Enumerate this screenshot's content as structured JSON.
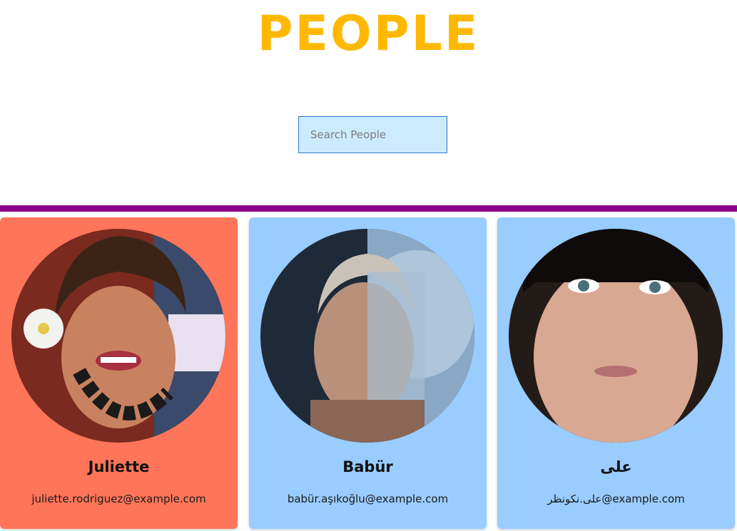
{
  "page": {
    "title": "PEOPLE",
    "title_color": "#FFB800",
    "divider_color": "#8B008B"
  },
  "search": {
    "placeholder": "Search People",
    "value": ""
  },
  "people": [
    {
      "name": "Juliette",
      "email": "juliette.rodriguez@example.com",
      "card_color": "#FF7559"
    },
    {
      "name": "Babür",
      "email": "babür.aşıkoğlu@example.com",
      "card_color": "#99CCFF"
    },
    {
      "name": "على",
      "email": "على.نكونظر@example.com",
      "card_color": "#99CCFF"
    }
  ]
}
